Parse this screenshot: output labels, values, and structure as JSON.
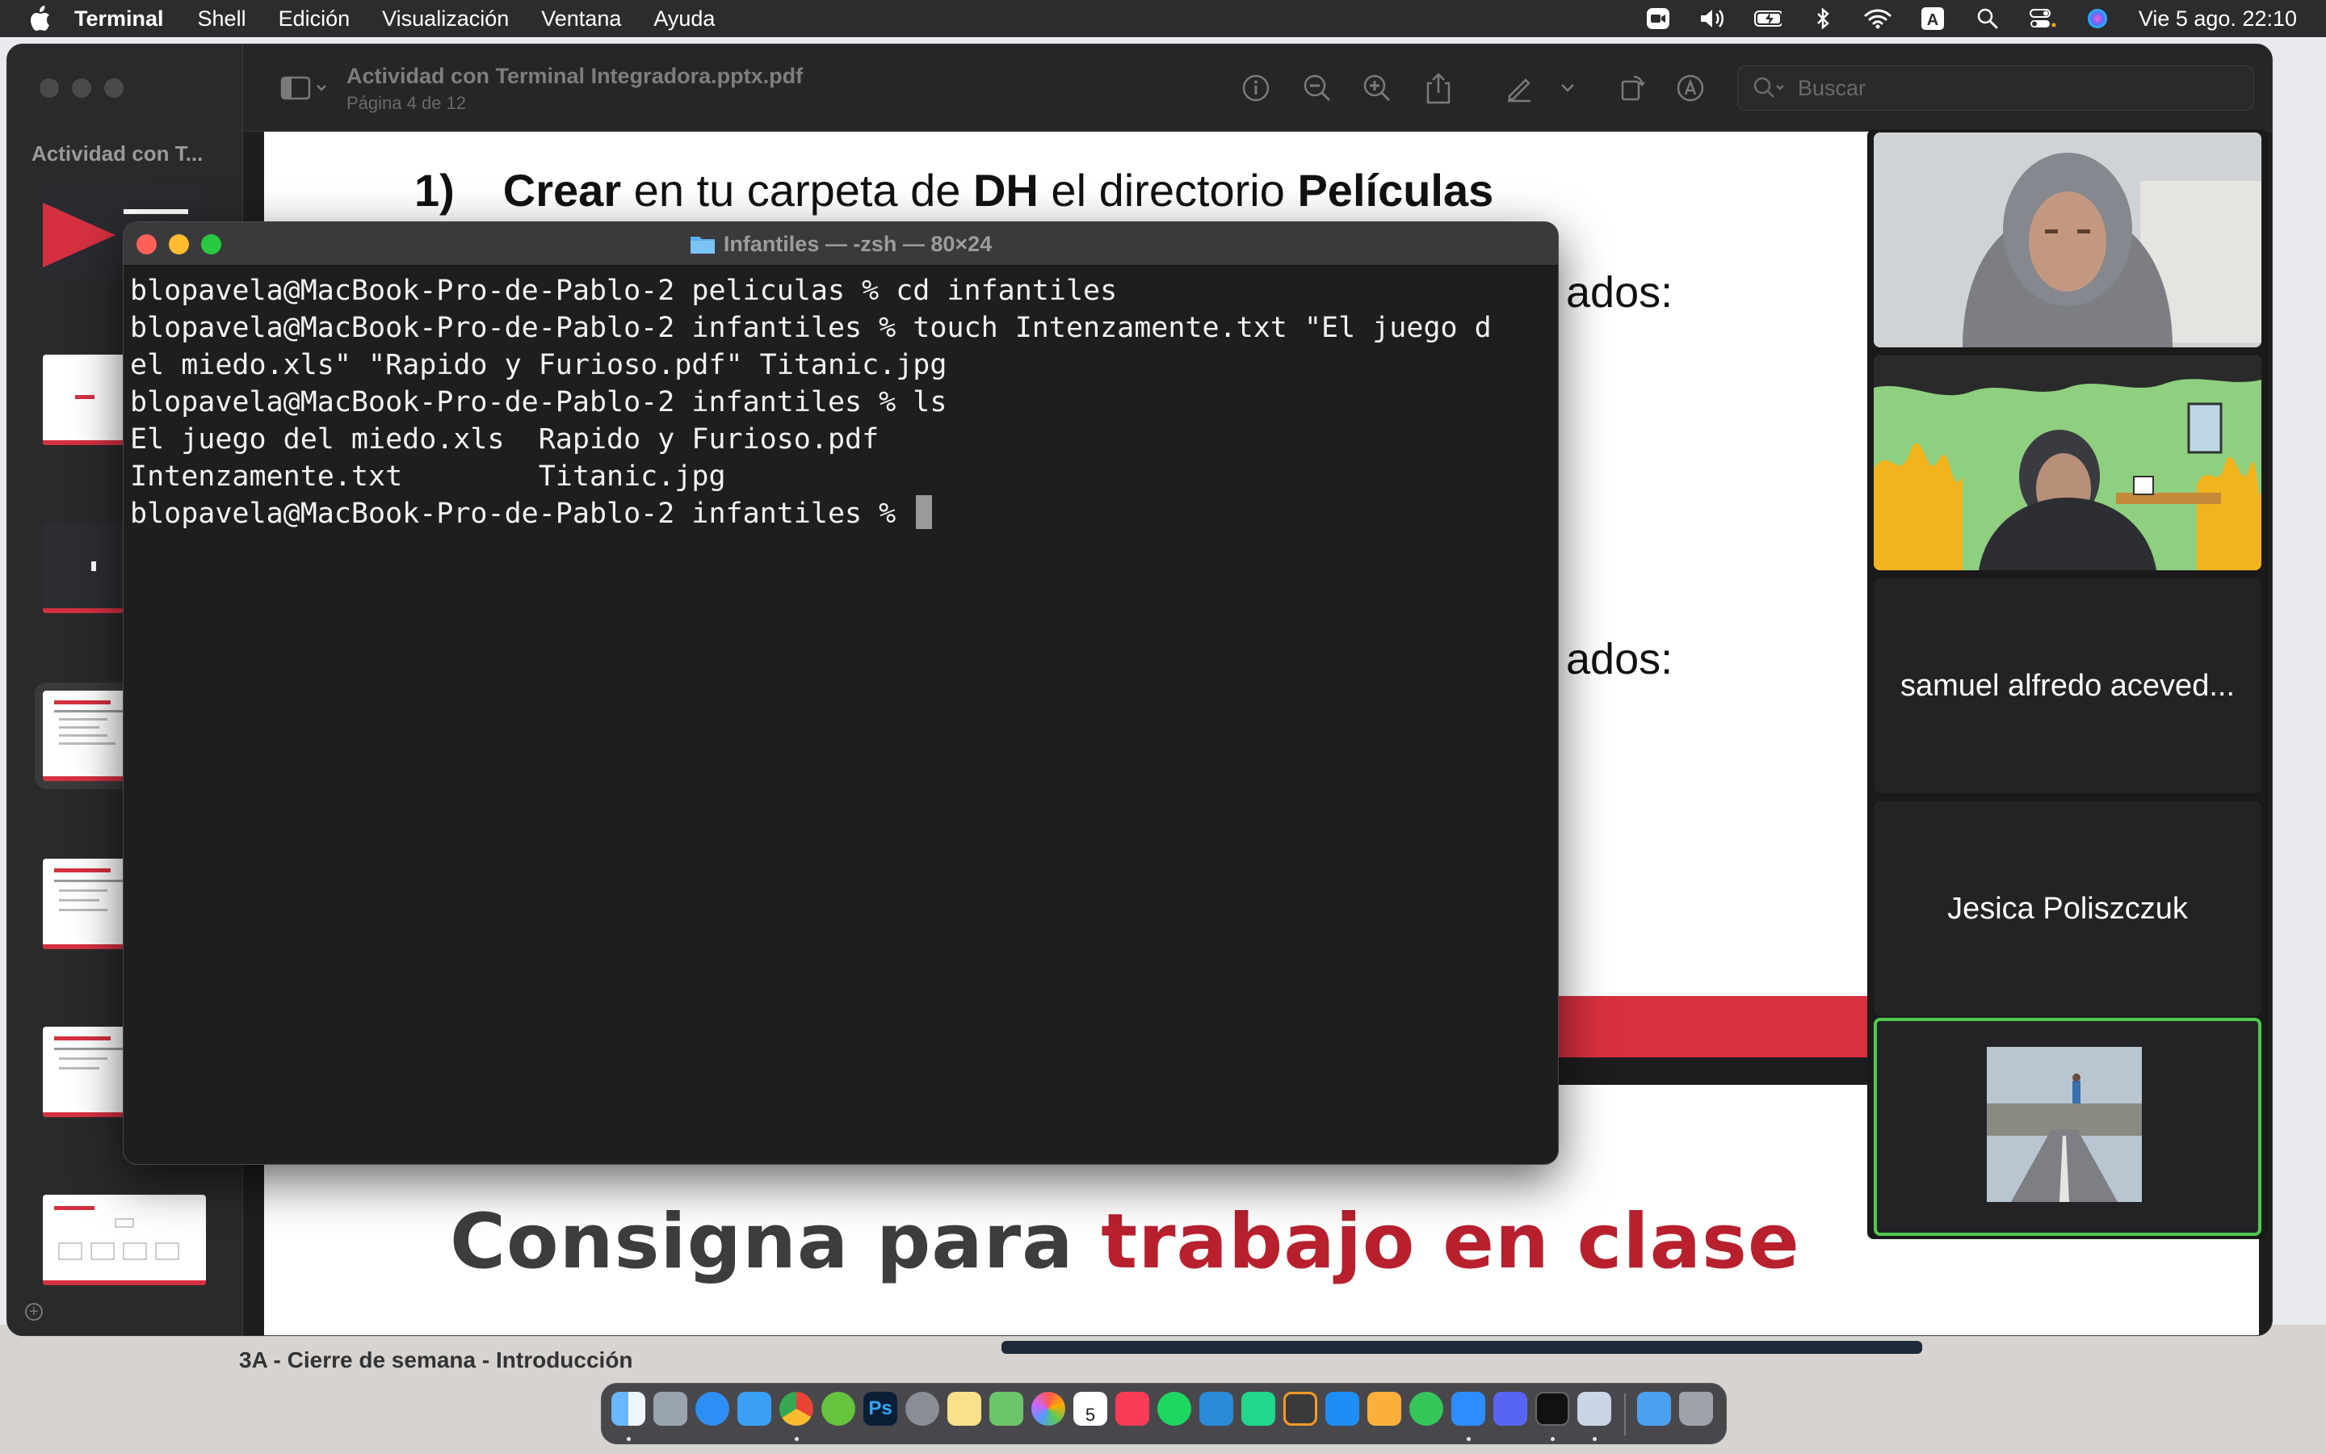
{
  "menubar": {
    "app_name": "Terminal",
    "items": [
      "Shell",
      "Edición",
      "Visualización",
      "Ventana",
      "Ayuda"
    ],
    "clock": "Vie 5 ago.  22:10"
  },
  "preview": {
    "sidebar_title": "Actividad con T...",
    "doc_title": "Actividad con Terminal Integradora.pptx.pdf",
    "page_info": "Página 4 de 12",
    "search_placeholder": "Buscar",
    "slide": {
      "step_number": "1)",
      "step_text_parts": [
        {
          "text": "Crear",
          "bold": true
        },
        {
          "text": " en tu carpeta de ",
          "bold": false
        },
        {
          "text": "DH",
          "bold": true
        },
        {
          "text": " el directorio ",
          "bold": false
        },
        {
          "text": "Películas",
          "bold": true
        }
      ],
      "fragment_1": "ados:",
      "fragment_2": "ados:",
      "big_title_gray": "Consigna para ",
      "big_title_red": "trabajo en clase"
    },
    "behind_text": "3A - Cierre de semana - Introducción"
  },
  "zoom": {
    "participants": [
      {
        "name": "",
        "type": "video"
      },
      {
        "name": "",
        "type": "video"
      },
      {
        "name": "samuel alfredo aceved...",
        "type": "name"
      },
      {
        "name": "Jesica Poliszczuk",
        "type": "name"
      },
      {
        "name": "",
        "type": "image"
      }
    ]
  },
  "terminal": {
    "title": "Infantiles — -zsh — 80×24",
    "lines": [
      "blopavela@MacBook-Pro-de-Pablo-2 peliculas % cd infantiles",
      "blopavela@MacBook-Pro-de-Pablo-2 infantiles % touch Intenzamente.txt \"El juego d",
      "el miedo.xls\" \"Rapido y Furioso.pdf\" Titanic.jpg",
      "blopavela@MacBook-Pro-de-Pablo-2 infantiles % ls",
      "El juego del miedo.xls  Rapido y Furioso.pdf",
      "Intenzamente.txt        Titanic.jpg",
      "blopavela@MacBook-Pro-de-Pablo-2 infantiles % "
    ]
  },
  "colors": {
    "accent_red": "#d7303e",
    "title_red": "#b8202e",
    "active_speaker_green": "#4fc94f",
    "terminal_bg": "#1e1e1e"
  },
  "dock": {
    "apps": [
      "finder-icon",
      "launchpad-icon",
      "safari-icon",
      "mail-icon",
      "chrome-icon",
      "utorrent-icon",
      "photoshop-icon",
      "system-preferences-icon",
      "notes-icon",
      "maps-icon",
      "photos-icon",
      "calendar-icon",
      "music-icon",
      "spotify-icon",
      "vscode-icon",
      "pycharm-icon",
      "sublime-icon",
      "appstore-icon",
      "pages-icon",
      "whatsapp-icon",
      "zoom-icon",
      "discord-icon",
      "terminal-icon",
      "preview-icon",
      "downloads-icon",
      "trash-icon"
    ],
    "calendar_day": "5"
  }
}
